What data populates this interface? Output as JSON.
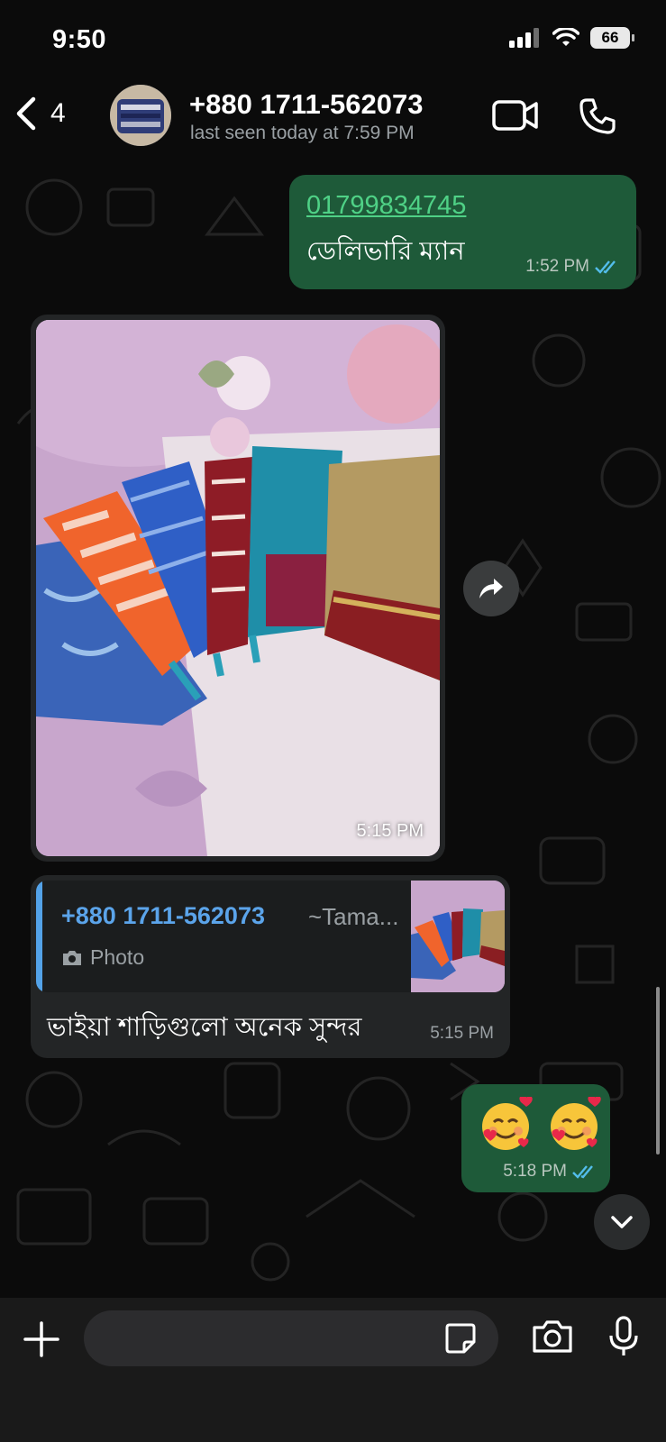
{
  "status_bar": {
    "time": "9:50",
    "battery": "66"
  },
  "header": {
    "back_count": "4",
    "contact_name": "+880 1711-562073",
    "last_seen": "last seen today at 7:59 PM"
  },
  "messages": [
    {
      "direction": "outgoing",
      "link": "01799834745",
      "text": "ডেলিভারি ম্যান",
      "time": "1:52 PM",
      "status": "read"
    },
    {
      "direction": "incoming",
      "type": "photo",
      "time": "5:15 PM"
    },
    {
      "direction": "incoming",
      "quote": {
        "name": "+880 1711-562073",
        "alias": "~Tama...",
        "type": "Photo"
      },
      "text": "ভাইয়া শাড়িগুলো অনেক সুন্দর",
      "time": "5:15 PM"
    },
    {
      "direction": "outgoing",
      "emoji": "🥰 🥰",
      "time": "5:18 PM",
      "status": "read"
    }
  ],
  "input": {
    "placeholder": ""
  },
  "colors": {
    "outgoing_bubble": "#1e5a39",
    "incoming_bubble": "#232526",
    "link": "#4fd186",
    "quote_accent": "#53a2e8",
    "read_ticks": "#53bdeb"
  },
  "icons": [
    "chevron-left-icon",
    "video-icon",
    "phone-icon",
    "forward-icon",
    "camera-icon",
    "sticker-icon",
    "mic-icon",
    "plus-icon",
    "chevron-down-icon"
  ]
}
